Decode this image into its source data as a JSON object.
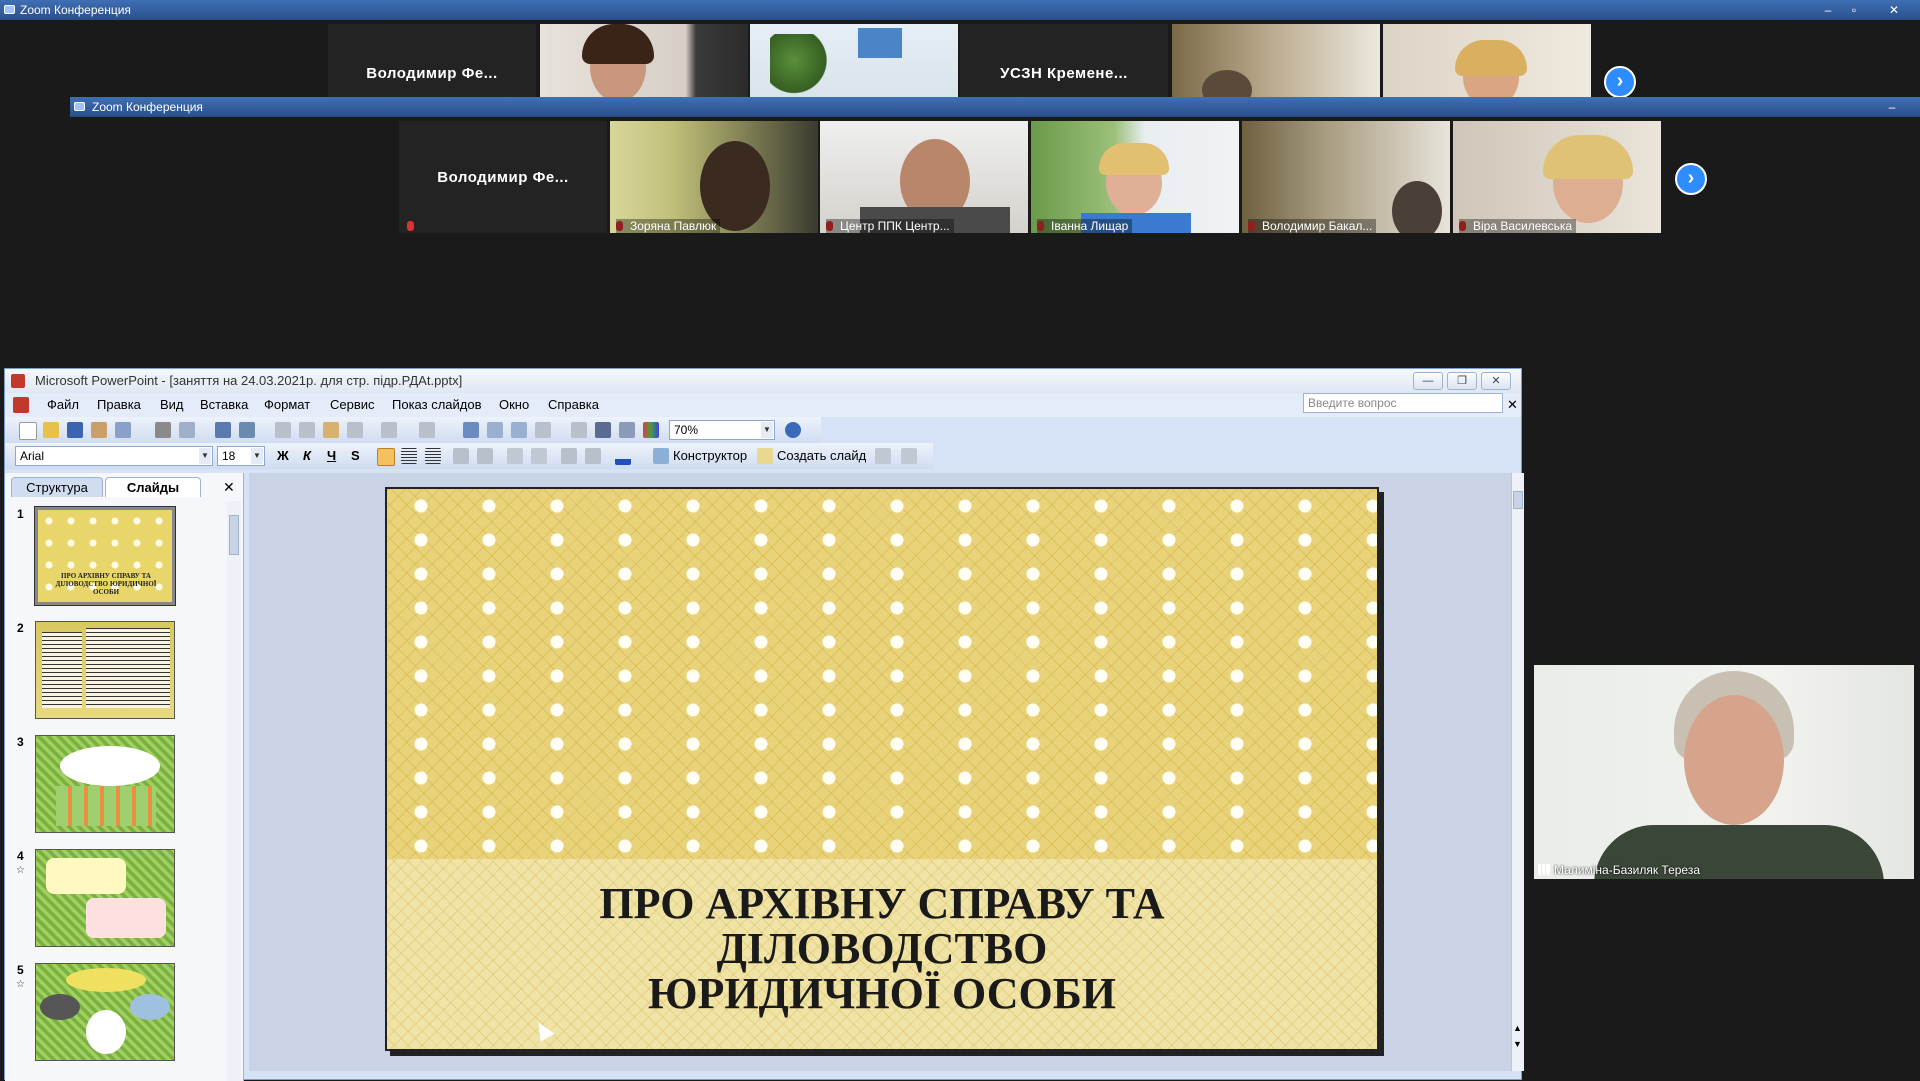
{
  "zoom_top": {
    "title": "Zoom Конференция",
    "tiles": [
      {
        "name": "Володимир  Фе..."
      },
      {
        "name": "УСЗН  Кремене..."
      }
    ]
  },
  "zoom_second": {
    "title": "Zoom Конференция",
    "name_tile": "Володимир  Фе...",
    "participants": [
      "Зоряна Павлюк",
      "Центр ППК Центр...",
      "Іванна Лищар",
      "Володимир Бакал...",
      "Віра Василевська"
    ]
  },
  "speaker": {
    "name": "Малиміна-Базиляк Тереза"
  },
  "powerpoint": {
    "title": "Microsoft PowerPoint - [заняття на 24.03.2021р. для стр. підр.РДАt.pptx]",
    "menu": [
      "Файл",
      "Правка",
      "Вид",
      "Вставка",
      "Формат",
      "Сервис",
      "Показ слайдов",
      "Окно",
      "Справка"
    ],
    "ask_placeholder": "Введите вопрос",
    "zoom": "70%",
    "font": "Arial",
    "font_size": "18",
    "format_buttons": [
      "Ж",
      "К",
      "Ч",
      "S"
    ],
    "designer_label": "Конструктор",
    "new_slide_label": "Создать слайд",
    "tabs": [
      "Структура",
      "Слайды"
    ],
    "slide_numbers": [
      "1",
      "2",
      "3",
      "4",
      "5"
    ],
    "thumb1_text": "ПРО АРХІВНУ СПРАВУ ТА ДІЛОВОДСТВО ЮРИДИЧНОЇ ОСОБИ",
    "slide_title_lines": [
      "ПРО АРХІВНУ СПРАВУ ТА",
      "ДІЛОВОДСТВО",
      "ЮРИДИЧНОЇ ОСОБИ"
    ]
  }
}
